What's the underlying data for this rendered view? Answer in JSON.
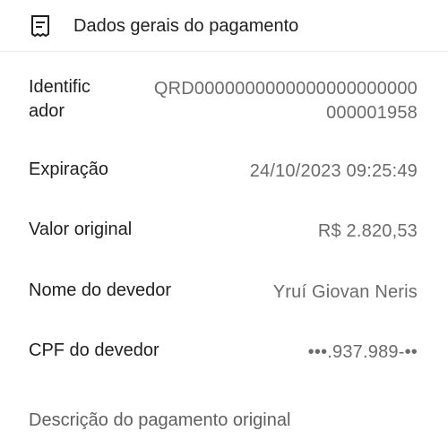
{
  "header": {
    "title": "Dados gerais do pagamento",
    "icon": "receipt-icon"
  },
  "rows": [
    {
      "label_line1": "Identific",
      "label_line2": "ador",
      "value_line1": "QRD0000000000000000000000",
      "value_line2": "000001958"
    },
    {
      "label": "Expiração",
      "value": "24/10/2023 09:25:49"
    },
    {
      "label": "Valor original",
      "value": "R$ 2.820,53"
    },
    {
      "label": "Nome do devedor",
      "value": "Yruí Giovan Neris"
    },
    {
      "label": "CPF do devedor",
      "value": "•••.937.989-••"
    }
  ],
  "section": {
    "title": "Descrição do pagamento original"
  }
}
